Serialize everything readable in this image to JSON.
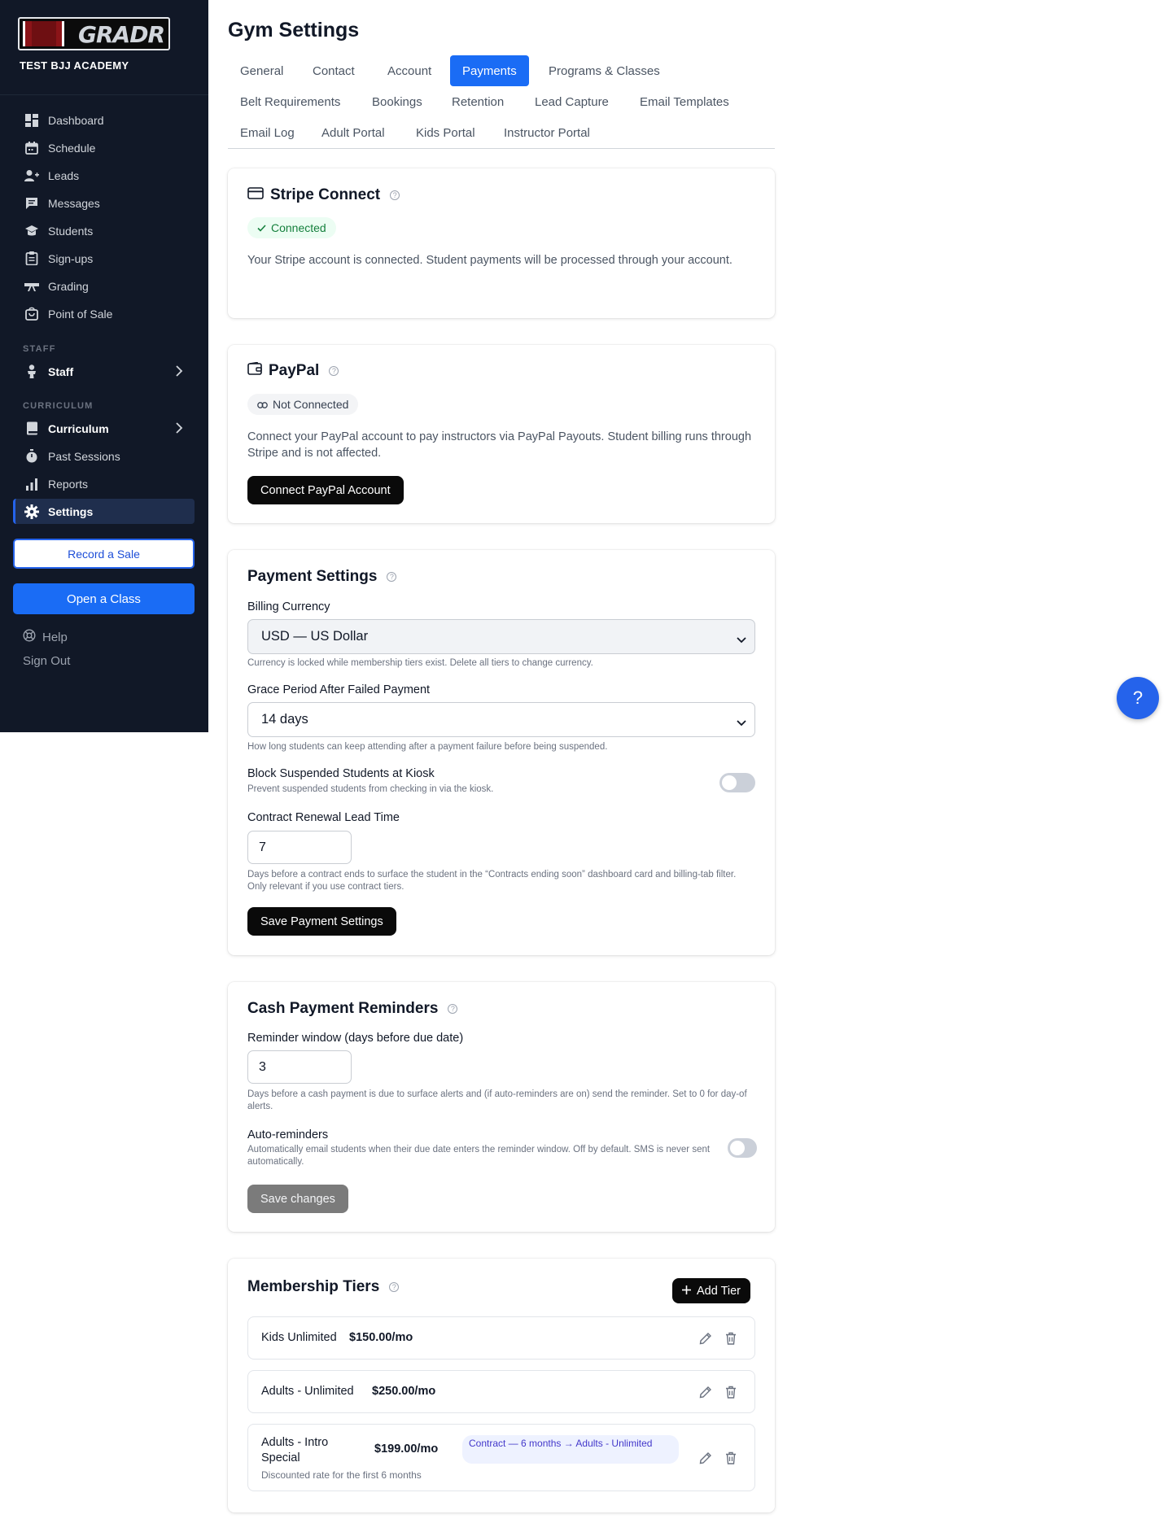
{
  "brand": {
    "logo_text": "GRADR",
    "gym_name": "TEST BJJ ACADEMY"
  },
  "sidebar": {
    "items": [
      {
        "label": "Dashboard",
        "icon": "dashboard-icon"
      },
      {
        "label": "Schedule",
        "icon": "calendar-icon"
      },
      {
        "label": "Leads",
        "icon": "add-user-icon"
      },
      {
        "label": "Messages",
        "icon": "chat-icon"
      },
      {
        "label": "Students",
        "icon": "students-icon"
      },
      {
        "label": "Sign-ups",
        "icon": "clipboard-icon"
      },
      {
        "label": "Grading",
        "icon": "belt-icon"
      },
      {
        "label": "Point of Sale",
        "icon": "cart-icon"
      }
    ],
    "staff_section": "STAFF",
    "staff_item": "Staff",
    "curriculum_section": "CURRICULUM",
    "curriculum_items": [
      {
        "label": "Curriculum"
      },
      {
        "label": "Past Sessions"
      },
      {
        "label": "Reports"
      },
      {
        "label": "Settings"
      }
    ],
    "record_sale": "Record a Sale",
    "open_class": "Open a Class",
    "help": "Help",
    "sign_out": "Sign Out"
  },
  "page": {
    "title": "Gym Settings"
  },
  "tabs": [
    "General",
    "Contact",
    "Account",
    "Payments",
    "Programs & Classes",
    "Belt Requirements",
    "Bookings",
    "Retention",
    "Lead Capture",
    "Email Templates",
    "Email Log",
    "Adult Portal",
    "Kids Portal",
    "Instructor Portal"
  ],
  "active_tab": "Payments",
  "stripe": {
    "title": "Stripe Connect",
    "status": "Connected",
    "description": "Your Stripe account is connected. Student payments will be processed through your account."
  },
  "paypal": {
    "title": "PayPal",
    "status": "Not Connected",
    "description": "Connect your PayPal account to pay instructors via PayPal Payouts. Student billing runs through Stripe and is not affected.",
    "button": "Connect PayPal Account"
  },
  "payment_settings": {
    "title": "Payment Settings",
    "currency_label": "Billing Currency",
    "currency_value": "USD — US Dollar",
    "currency_hint": "Currency is locked while membership tiers exist. Delete all tiers to change currency.",
    "grace_label": "Grace Period After Failed Payment",
    "grace_value": "14 days",
    "grace_hint": "How long students can keep attending after a payment failure before being suspended.",
    "block_label": "Block Suspended Students at Kiosk",
    "block_hint": "Prevent suspended students from checking in via the kiosk.",
    "block_enabled": false,
    "renewal_label": "Contract Renewal Lead Time",
    "renewal_value": "7",
    "renewal_hint": "Days before a contract ends to surface the student in the “Contracts ending soon” dashboard card and billing-tab filter. Only relevant if you use contract tiers.",
    "save_button": "Save Payment Settings"
  },
  "cash_reminders": {
    "title": "Cash Payment Reminders",
    "window_label": "Reminder window (days before due date)",
    "window_value": "3",
    "window_hint": "Days before a cash payment is due to surface alerts and (if auto-reminders are on) send the reminder. Set to 0 for day-of alerts.",
    "auto_label": "Auto-reminders",
    "auto_hint": "Automatically email students when their due date enters the reminder window. Off by default. SMS is never sent automatically.",
    "auto_enabled": false,
    "save_button": "Save changes"
  },
  "membership": {
    "title": "Membership Tiers",
    "add_button": "Add Tier",
    "tiers": [
      {
        "name": "Kids Unlimited",
        "price": "$150.00/mo"
      },
      {
        "name": "Adults - Unlimited",
        "price": "$250.00/mo"
      },
      {
        "name": "Adults - Intro Special",
        "price": "$199.00/mo",
        "badge": "Contract — 6 months → Adults - Unlimited",
        "description": "Discounted rate for the first 6 months"
      }
    ]
  },
  "fab": {
    "label": "?"
  },
  "colors": {
    "accent": "#1a6cf5",
    "sidebar_bg": "#111827",
    "success": "#15803d"
  }
}
